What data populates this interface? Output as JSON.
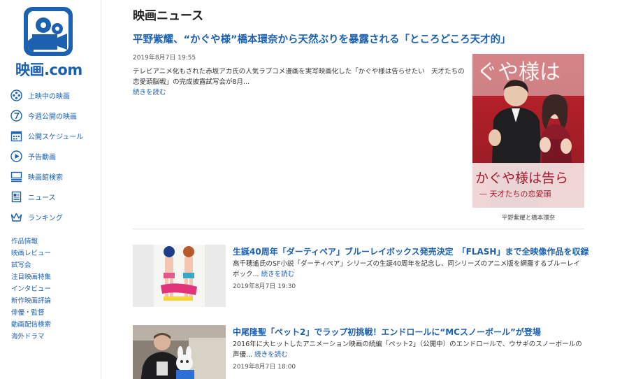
{
  "brand": {
    "logo_text": "映画.com",
    "color": "#1c60b0"
  },
  "sidebar": {
    "nav": [
      {
        "label": "上映中の映画",
        "icon": "film-reel-icon"
      },
      {
        "label": "今週公開の映画",
        "icon": "number-seven-icon"
      },
      {
        "label": "公開スケジュール",
        "icon": "calendar-icon"
      },
      {
        "label": "予告動画",
        "icon": "play-icon"
      },
      {
        "label": "映画館検索",
        "icon": "theater-icon"
      },
      {
        "label": "ニュース",
        "icon": "news-icon"
      },
      {
        "label": "ランキング",
        "icon": "crown-icon"
      }
    ],
    "links": [
      "作品情報",
      "映画レビュー",
      "試写会",
      "注目映画特集",
      "インタビュー",
      "新作映画評論",
      "俳優・監督",
      "動画配信検索",
      "海外ドラマ"
    ]
  },
  "main": {
    "section_title": "映画ニュース",
    "feature": {
      "title": "平野紫耀、“かぐや様”橋本環奈から天然ぶりを暴露される「ところどころ天才的」",
      "date": "2019年8月7日 19:55",
      "body": "テレビアニメ化もされた赤坂アカ氏の人気ラブコメ漫画を実写映画化した「かぐや様は告らせたい　天才たちの恋愛頭脳戦」の完成披露試写会が8月...",
      "more": "続きを読む",
      "image_caption": "平野紫耀と橋本環奈",
      "image_text_top": "ぐや様は",
      "image_text_mid": "かぐや様は告ら",
      "image_text_sub": "— 天才たちの恋愛頭"
    },
    "articles": [
      {
        "title": "生誕40周年「ダーティペア」ブルーレイボックス発売決定　「FLASH」まで全映像作品を収録",
        "body": "高千穂遙氏のSF小説「ダーティペア」シリーズの生誕40周年を記念し、同シリーズのアニメ版を網羅するブルーレイボック...",
        "more": "続きを読む",
        "date": "2019年8月7日 19:30"
      },
      {
        "title": "中尾隆聖「ペット2」でラップ初挑戦！エンドロールに“MCスノーボール”が登場",
        "body": "2016年に大ヒットしたアニメーション映画の続編「ペット2」（公開中）のエンドロールで、ウサギのスノーボールの声優...",
        "more": "続きを読む",
        "date": "2019年8月7日 18:00"
      }
    ]
  }
}
